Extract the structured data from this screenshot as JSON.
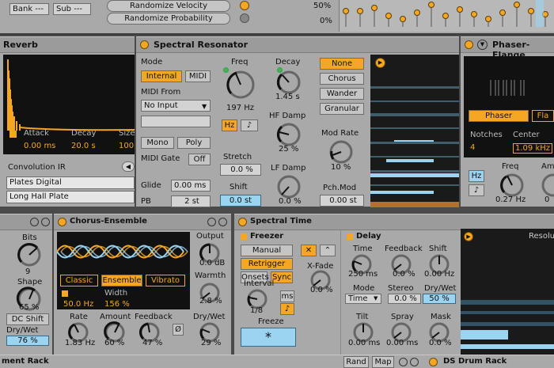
{
  "top": {
    "bank": "Bank ---",
    "sub": "Sub ---",
    "rand_vel": "Randomize Velocity",
    "rand_prob": "Randomize Probability",
    "pct50": "50%",
    "pct0": "0%"
  },
  "reverb": {
    "title": "Reverb",
    "attack": "Attack",
    "decay": "Decay",
    "size": "Size",
    "attack_val": "0.00 ms",
    "decay_val": "20.0 s",
    "size_val": "100",
    "conv_ir": "Convolution IR",
    "ir1": "Plates Digital",
    "ir2": "Long Hall Plate"
  },
  "spectral": {
    "title": "Spectral Resonator",
    "mode": "Mode",
    "internal": "Internal",
    "midi": "MIDI",
    "midi_from": "MIDI From",
    "no_input": "No Input",
    "mono": "Mono",
    "poly": "Poly",
    "midi_gate": "MIDI Gate",
    "off": "Off",
    "glide": "Glide",
    "glide_val": "0.00 ms",
    "pb": "PB",
    "pb_val": "2 st",
    "freq": "Freq",
    "freq_val": "197 Hz",
    "hz": "Hz",
    "decay": "Decay",
    "decay_val": "1.45 s",
    "hf_damp": "HF Damp",
    "hf_val": "25 %",
    "stretch": "Stretch",
    "stretch_val": "0.0 %",
    "lf_damp": "LF Damp",
    "lf_val": "0.0 %",
    "shift": "Shift",
    "shift_val": "0.0 st",
    "modes": [
      "None",
      "Chorus",
      "Wander",
      "Granular"
    ],
    "mod_rate": "Mod Rate",
    "mod_val": "10 %",
    "pch_mod": "Pch.Mod",
    "pch_val": "0.00 st"
  },
  "phaser": {
    "title": "Phaser-Flange",
    "phaser": "Phaser",
    "flanger": "Fla",
    "notches": "Notches",
    "notches_val": "4",
    "center": "Center",
    "center_val": "1.09 kHz",
    "hz": "Hz",
    "freq": "Freq",
    "freq_val": "0.27 Hz",
    "amount": "Am"
  },
  "leftdev": {
    "bits": "Bits",
    "bits_val": "9",
    "shape": "Shape",
    "shape_val": "65 %",
    "dc_shift": "DC Shift",
    "drywet": "Dry/Wet",
    "drywet_val": "76 %"
  },
  "chorus": {
    "title": "Chorus-Ensemble",
    "modes": [
      "Classic",
      "Ensemble",
      "Vibrato"
    ],
    "rate_top": "50.0 Hz",
    "width": "Width",
    "width_val": "156 %",
    "output": "Output",
    "output_val": "0.0 dB",
    "warmth": "Warmth",
    "warmth_val": "2.8 %",
    "rate": "Rate",
    "rate_val": "1.83 Hz",
    "amount": "Amount",
    "amount_val": "60 %",
    "feedback": "Feedback",
    "feedback_val": "47 %",
    "phi": "Ø",
    "drywet": "Dry/Wet",
    "drywet_val": "29 %"
  },
  "stime": {
    "title": "Spectral Time",
    "freezer": "Freezer",
    "manual": "Manual",
    "retrigger": "Retrigger",
    "onsets": "Onsets",
    "sync": "Sync",
    "xfade": "X-Fade",
    "xfade_val": "0.0 %",
    "interval": "Interval",
    "interval_val": "1/8",
    "ms": "ms",
    "freeze": "Freeze",
    "star": "*",
    "delay": "Delay",
    "time": "Time",
    "time_val": "250 ms",
    "feedback": "Feedback",
    "feedback_val": "0.0 %",
    "shift": "Shift",
    "shift_val": "0.00 Hz",
    "mode": "Mode",
    "mode_val": "Time",
    "stereo": "Stereo",
    "stereo_val": "0.0 %",
    "drywet": "Dry/Wet",
    "drywet_val": "50 %",
    "tilt": "Tilt",
    "tilt_val": "0.00 ms",
    "spray": "Spray",
    "spray_val": "0.00 ms",
    "mask": "Mask",
    "mask_val": "0.0 %",
    "resolution": "Resolu"
  },
  "bottom": {
    "rack": "ment Rack",
    "rand": "Rand",
    "map": "Map",
    "ds_rack": "DS Drum Rack"
  }
}
